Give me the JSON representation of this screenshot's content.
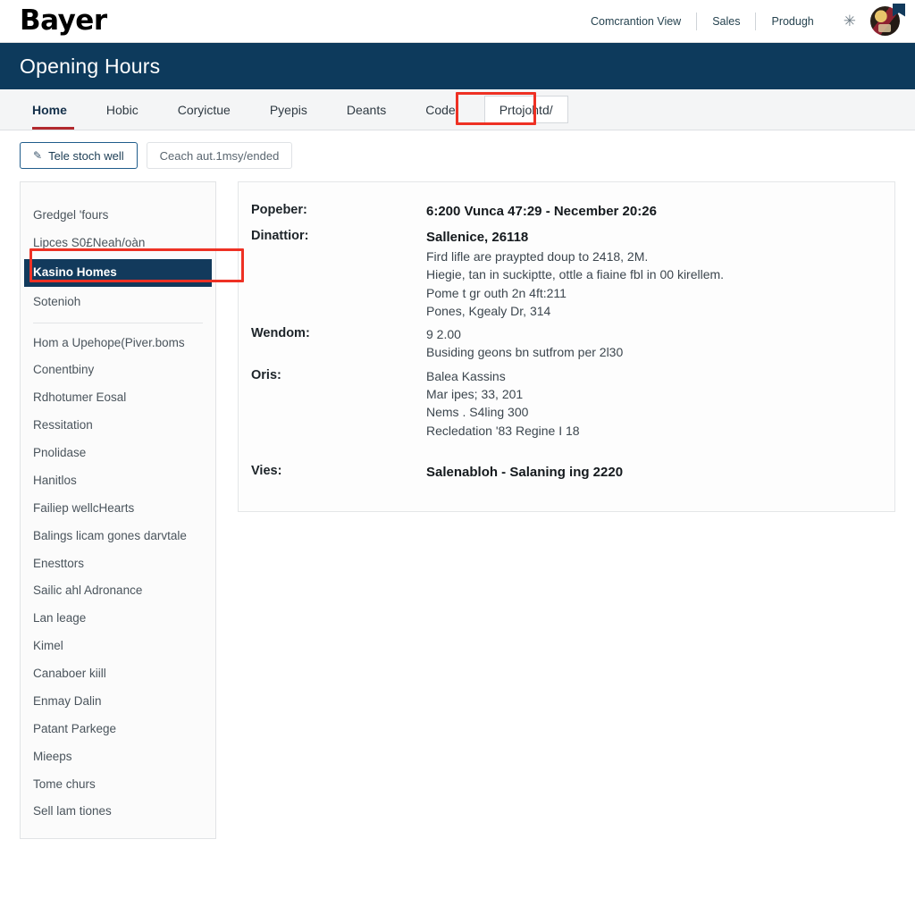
{
  "topbar": {
    "brand": "Bayer",
    "links": [
      {
        "label": "Comcrantion View"
      },
      {
        "label": "Sales"
      },
      {
        "label": "Produgh"
      }
    ],
    "star_glyph": "✳",
    "icons": {
      "star": "star-icon",
      "avatar": "avatar",
      "badge": "avatar-badge"
    }
  },
  "title_band": {
    "title": "Opening Hours",
    "bg": "#0d3a5c"
  },
  "tabs": [
    {
      "label": "Home",
      "active": true
    },
    {
      "label": "Hobic",
      "active": false
    },
    {
      "label": "Coryictue",
      "active": false
    },
    {
      "label": "Pyepis",
      "active": false
    },
    {
      "label": "Deants",
      "active": false
    },
    {
      "label": "Code",
      "active": false
    },
    {
      "label": "Prtojohtd/",
      "active": false,
      "boxed": true,
      "annotated": true
    }
  ],
  "actions": {
    "primary_label": "Tele stoch well",
    "primary_icon": "pencil-icon",
    "secondary_label": "Ceach aut.1msy/ended"
  },
  "sidebar": {
    "items": [
      {
        "label": "Gredgel 'fours",
        "selected": false
      },
      {
        "label": "Lipces S0£Neah/oàn",
        "selected": false
      },
      {
        "label": "Kasino  Homes",
        "selected": true,
        "annotated": true
      },
      {
        "label": "Sotenioh",
        "selected": false
      },
      {
        "divider": true
      },
      {
        "label": "Hom a Upehope(Piver.boms",
        "selected": false
      },
      {
        "label": "Conentbiny",
        "selected": false
      },
      {
        "label": "Rdhotumer Eosal",
        "selected": false
      },
      {
        "label": "Ressitation",
        "selected": false
      },
      {
        "label": "Pnolidase",
        "selected": false
      },
      {
        "label": "Hanitlos",
        "selected": false
      },
      {
        "label": "Failiep wellcHearts",
        "selected": false
      },
      {
        "label": "Balings licam gones darvtale",
        "selected": false
      },
      {
        "label": "Enesttors",
        "selected": false
      },
      {
        "label": "Sailic ahl Adronance",
        "selected": false
      },
      {
        "label": "Lan leage",
        "selected": false
      },
      {
        "label": "Kimel",
        "selected": false
      },
      {
        "label": "Canaboer kiill",
        "selected": false
      },
      {
        "label": "Enmay Dalin",
        "selected": false
      },
      {
        "label": "Patant Parkege",
        "selected": false
      },
      {
        "label": "Mieeps",
        "selected": false
      },
      {
        "label": "Tome churs",
        "selected": false
      },
      {
        "label": "Sell lam tiones",
        "selected": false
      }
    ]
  },
  "detail": {
    "rows": [
      {
        "label": "Popeber:",
        "values": [
          {
            "text": "6:200 Vunca 47:29 - Necember 20:26",
            "strong": true
          }
        ]
      },
      {
        "label": "Dinattior:",
        "values": [
          {
            "text": "Sallenice, 26118",
            "strong": true
          },
          {
            "text": "Fird lifle are praypted doup to 2418, 2M.",
            "strong": false
          },
          {
            "text": "Hiegie, tan in suckiptte, ottle a fiaine fbl in  00 kirellem.",
            "strong": false
          },
          {
            "text": "Pome t gr outh 2n 4ft:211",
            "strong": false
          },
          {
            "text": "Pones, Kgealy Dr, 314",
            "strong": false
          }
        ]
      },
      {
        "label": "Wendom:",
        "values": [
          {
            "text": "9 2.00",
            "strong": false
          },
          {
            "text": "Busiding geons bn sutfrom per  2l30",
            "strong": false
          }
        ]
      },
      {
        "label": "Oris:",
        "values": [
          {
            "text": "Balea Kassins",
            "strong": false
          },
          {
            "text": "Mar ipes; 33, 201",
            "strong": false
          },
          {
            "text": "Nems . S4ling 300",
            "strong": false
          },
          {
            "text": "Recledation '83 Regine I 18",
            "strong": false
          }
        ]
      },
      {
        "label": "Vies:",
        "values": [
          {
            "text": "Salenabloh - Salaning ing 2220",
            "strong": true
          }
        ]
      }
    ]
  },
  "colors": {
    "navy": "#0d3a5c",
    "annotation_red": "#ee3124",
    "tab_underline_red": "#b2292e",
    "selected_item_bg": "#123a5c"
  }
}
